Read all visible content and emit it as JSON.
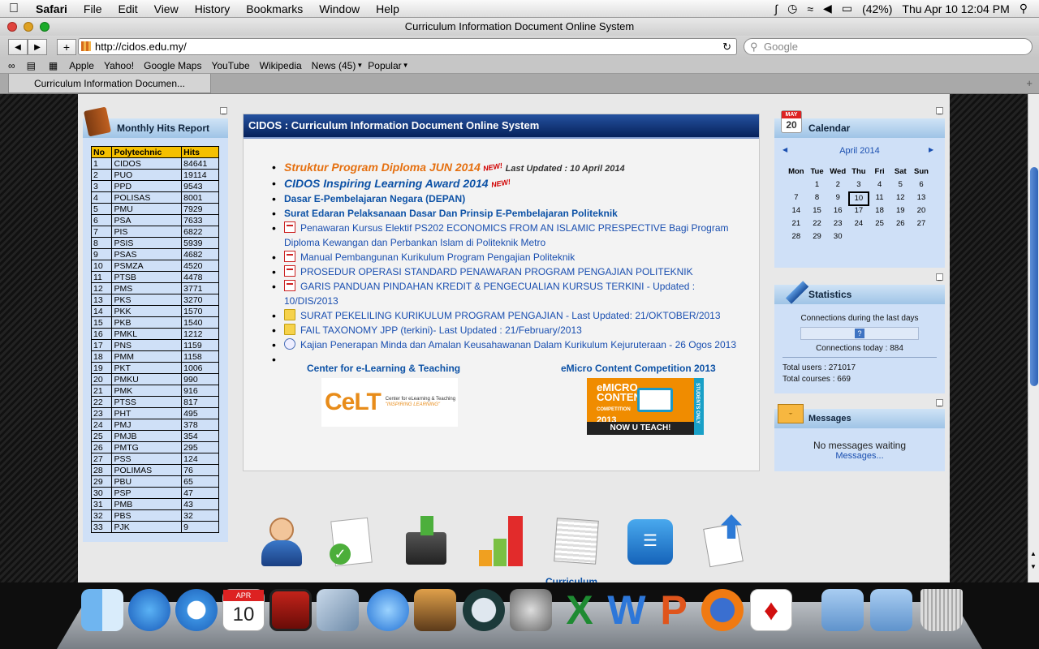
{
  "menubar": {
    "app": "Safari",
    "items": [
      "File",
      "Edit",
      "View",
      "History",
      "Bookmarks",
      "Window",
      "Help"
    ],
    "battery": "(42%)",
    "clock": "Thu Apr 10  12:04 PM"
  },
  "window": {
    "title": "Curriculum Information Document Online System"
  },
  "toolbar": {
    "url": "http://cidos.edu.my/",
    "search_placeholder": "Google"
  },
  "bookmarks": {
    "items": [
      "Apple",
      "Yahoo!",
      "Google Maps",
      "YouTube",
      "Wikipedia",
      "News (45)",
      "Popular"
    ]
  },
  "tab": {
    "label": "Curriculum Information Documen..."
  },
  "hits_report": {
    "title": "Monthly Hits Report",
    "headers": [
      "No",
      "Polytechnic",
      "Hits"
    ],
    "rows": [
      [
        "1",
        "CIDOS",
        "84641"
      ],
      [
        "2",
        "PUO",
        "19114"
      ],
      [
        "3",
        "PPD",
        "9543"
      ],
      [
        "4",
        "POLISAS",
        "8001"
      ],
      [
        "5",
        "PMU",
        "7929"
      ],
      [
        "6",
        "PSA",
        "7633"
      ],
      [
        "7",
        "PIS",
        "6822"
      ],
      [
        "8",
        "PSIS",
        "5939"
      ],
      [
        "9",
        "PSAS",
        "4682"
      ],
      [
        "10",
        "PSMZA",
        "4520"
      ],
      [
        "11",
        "PTSB",
        "4478"
      ],
      [
        "12",
        "PMS",
        "3771"
      ],
      [
        "13",
        "PKS",
        "3270"
      ],
      [
        "14",
        "PKK",
        "1570"
      ],
      [
        "15",
        "PKB",
        "1540"
      ],
      [
        "16",
        "PMKL",
        "1212"
      ],
      [
        "17",
        "PNS",
        "1159"
      ],
      [
        "18",
        "PMM",
        "1158"
      ],
      [
        "19",
        "PKT",
        "1006"
      ],
      [
        "20",
        "PMKU",
        "990"
      ],
      [
        "21",
        "PMK",
        "916"
      ],
      [
        "22",
        "PTSS",
        "817"
      ],
      [
        "23",
        "PHT",
        "495"
      ],
      [
        "24",
        "PMJ",
        "378"
      ],
      [
        "25",
        "PMJB",
        "354"
      ],
      [
        "26",
        "PMTG",
        "295"
      ],
      [
        "27",
        "PSS",
        "124"
      ],
      [
        "28",
        "POLIMAS",
        "76"
      ],
      [
        "29",
        "PBU",
        "65"
      ],
      [
        "30",
        "PSP",
        "47"
      ],
      [
        "31",
        "PMB",
        "43"
      ],
      [
        "32",
        "PBS",
        "32"
      ],
      [
        "33",
        "PJK",
        "9"
      ]
    ]
  },
  "main": {
    "header": "CIDOS : Curriculum Information Document Online System",
    "news": [
      {
        "text": "Struktur Program Diploma JUN 2014",
        "badge": "NEW!",
        "updated": "Last Updated : 10 April 2014"
      },
      {
        "text": "CIDOS Inspiring Learning Award 2014",
        "badge": "NEW!"
      },
      {
        "text": "Dasar E-Pembelajaran Negara (DEPAN)"
      },
      {
        "text": "Surat Edaran Pelaksanaan Dasar Dan Prinsip E-Pembelajaran Politeknik"
      },
      {
        "text": "Penawaran Kursus Elektif PS202 ECONOMICS FROM AN ISLAMIC PRESPECTIVE Bagi Program Diploma Kewangan dan Perbankan Islam di Politeknik Metro",
        "icon": "pdf-icon"
      },
      {
        "text": "Manual Pembangunan Kurikulum Program Pengajian Politeknik",
        "icon": "pdf-icon"
      },
      {
        "text": "PROSEDUR OPERASI STANDARD PENAWARAN PROGRAM PENGAJIAN POLITEKNIK",
        "icon": "pdf-icon"
      },
      {
        "text": "GARIS PANDUAN PINDAHAN KREDIT & PENGECUALIAN KURSUS TERKINI - Updated : 10/DIS/2013",
        "icon": "pdf-icon"
      },
      {
        "text": "SURAT PEKELILING KURIKULUM PROGRAM PENGAJIAN - Last Updated: 21/OKTOBER/2013",
        "icon": "folder-icon"
      },
      {
        "text": "FAIL TAXONOMY JPP (terkini)- Last Updated : 21/February/2013",
        "icon": "folder-icon"
      },
      {
        "text": "Kajian Penerapan Minda dan Amalan Keusahawanan Dalam Kurikulum Kejuruteraan - 26 Ogos 2013",
        "icon": "web-link-icon"
      }
    ],
    "promo_left": {
      "title": "Center for e-Learning & Teaching",
      "logo": "CeLT",
      "tagline": "Center for eLearning & Teaching",
      "slogan": "\"INSPIRING LEARNING\""
    },
    "promo_right": {
      "title": "eMicro Content Competition 2013",
      "line1": "eMICRO",
      "line2": "CONTENT",
      "line3": "COMPETITION",
      "year": "2013",
      "cta": "NOW U TEACH!",
      "side": "STUDENTS ONLY"
    },
    "cut_label": "Curriculum"
  },
  "calendar": {
    "title": "Calendar",
    "icon_month": "MAY",
    "icon_day": "20",
    "month": "April 2014",
    "days": [
      "Mon",
      "Tue",
      "Wed",
      "Thu",
      "Fri",
      "Sat",
      "Sun"
    ],
    "weeks": [
      [
        "",
        "1",
        "2",
        "3",
        "4",
        "5",
        "6"
      ],
      [
        "7",
        "8",
        "9",
        "10",
        "11",
        "12",
        "13"
      ],
      [
        "14",
        "15",
        "16",
        "17",
        "18",
        "19",
        "20"
      ],
      [
        "21",
        "22",
        "23",
        "24",
        "25",
        "26",
        "27"
      ],
      [
        "28",
        "29",
        "30",
        "",
        "",
        "",
        ""
      ]
    ],
    "today": "10"
  },
  "statistics": {
    "title": "Statistics",
    "connections_label": "Connections during the last days",
    "graph_placeholder": "?",
    "today": "Connections today : 884",
    "users": "Total users : 271017",
    "courses": "Total courses : 669"
  },
  "messages": {
    "title": "Messages",
    "status": "No messages waiting",
    "link": "Messages..."
  },
  "dock": {
    "calendar_month": "APR",
    "calendar_day": "10"
  }
}
